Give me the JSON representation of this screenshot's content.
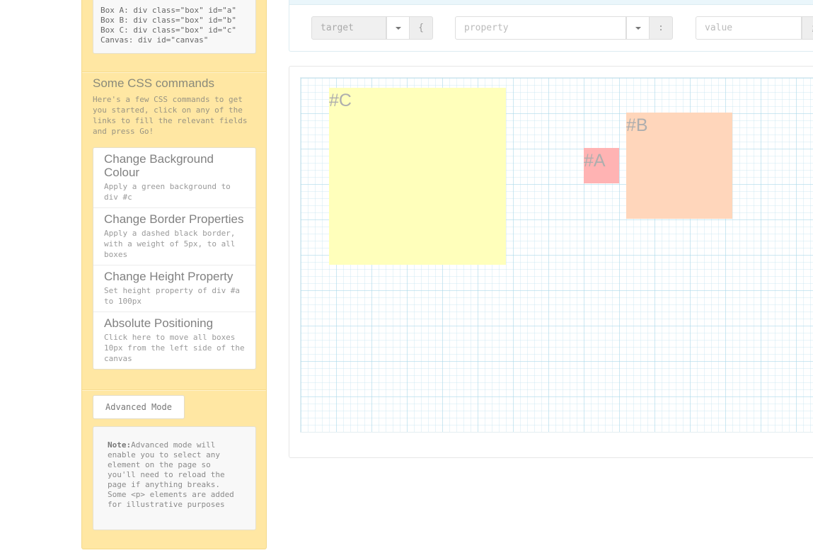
{
  "colors": {
    "sidebar_bg": "#ffe7a3",
    "box_a": "#ffb3b3",
    "box_b": "#ffd6bb",
    "box_c": "#ffffbb"
  },
  "sidebar": {
    "code_lines": [
      "Box A: div class=\"box\" id=\"a\"",
      "Box B: div class=\"box\" id=\"b\"",
      "Box C: div class=\"box\" id=\"c\"",
      "Canvas: div id=\"canvas\""
    ],
    "css_title": "Some CSS commands",
    "css_intro": "Here's a few CSS commands to get you started, click on any of the links to fill the relevant fields and press Go!",
    "commands": [
      {
        "title": "Change Background Colour",
        "desc": "Apply a green background to div #c"
      },
      {
        "title": "Change Border Properties",
        "desc": "Apply a dashed black border, with a weight of 5px, to all boxes"
      },
      {
        "title": "Change Height Property",
        "desc": "Set height property of div #a to 100px"
      },
      {
        "title": "Absolute Positioning",
        "desc": "Click here to move all boxes 10px from the left side of the canvas"
      }
    ],
    "advanced_button": "Advanced Mode",
    "note_label": "Note:",
    "note_text": "Advanced mode will enable you to select any element on the page so you'll need to reload the page if anything breaks. Some <p> elements are added for illustrative purposes"
  },
  "toolbar": {
    "target_placeholder": "target",
    "target_addon": "{",
    "property_placeholder": "property",
    "property_addon": ":",
    "value_placeholder": "value",
    "value_addon": ";"
  },
  "canvas": {
    "box_a_label": "#A",
    "box_b_label": "#B",
    "box_c_label": "#C"
  }
}
